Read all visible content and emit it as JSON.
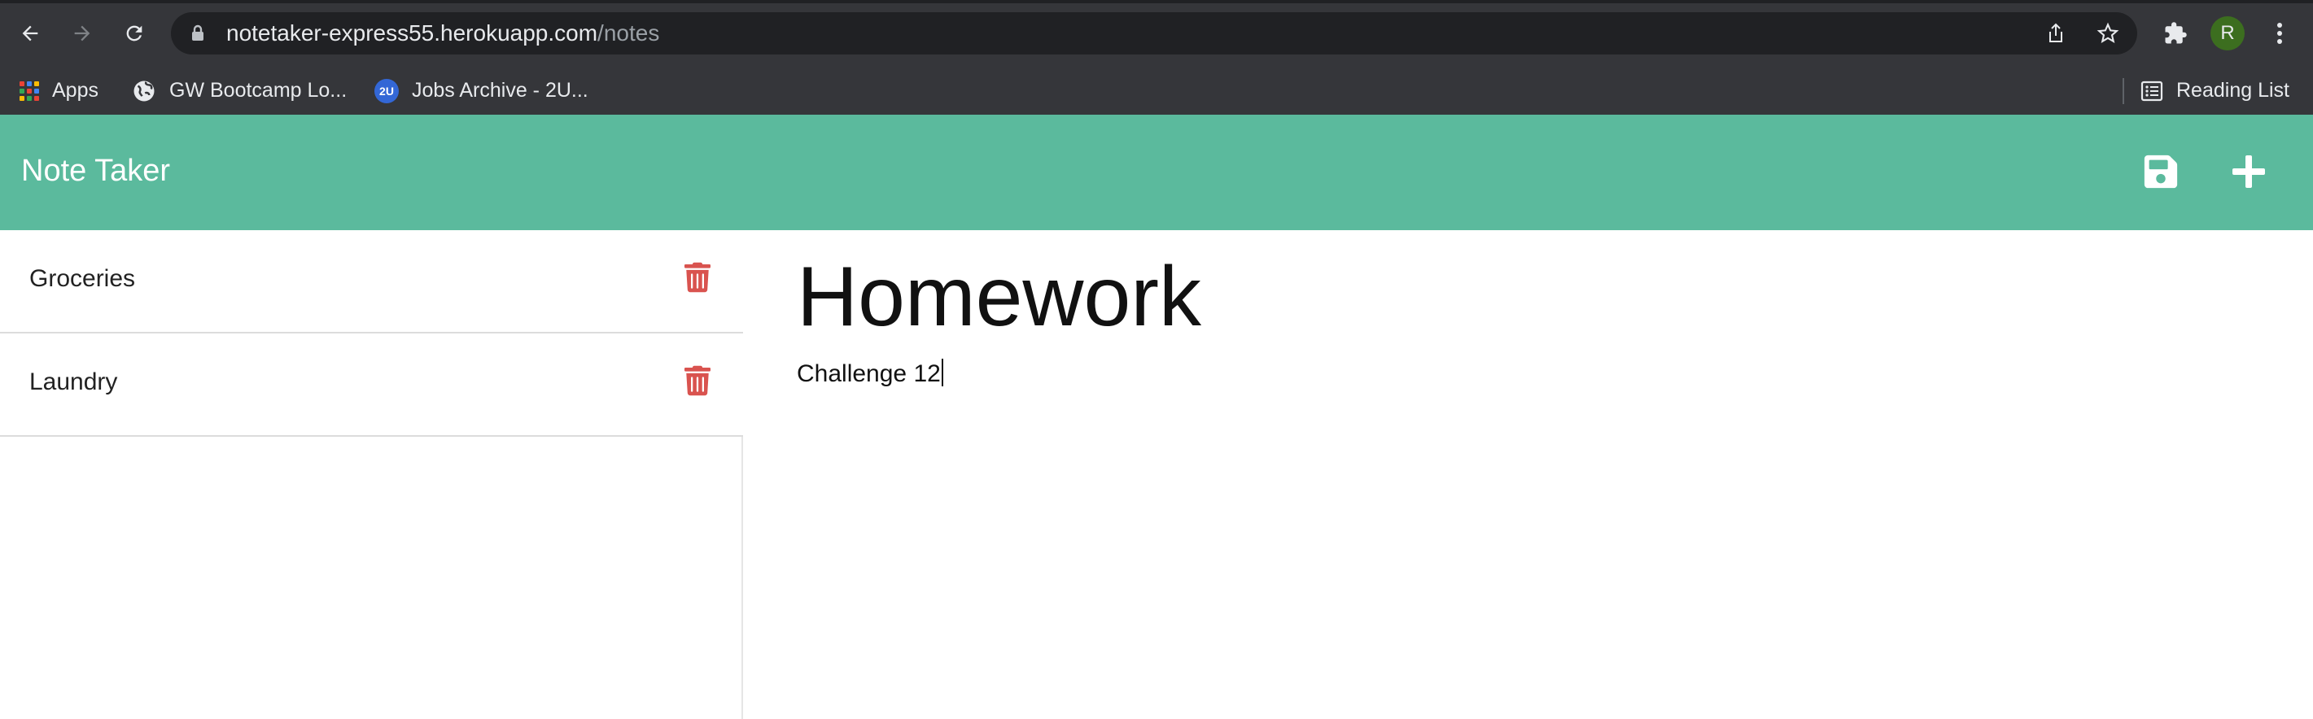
{
  "browser": {
    "url_host": "notetaker-express55.herokuapp.com",
    "url_path": "/notes",
    "profile_initial": "R",
    "bookmarks": [
      {
        "label": "Apps",
        "icon": "apps-grid-icon"
      },
      {
        "label": "GW Bootcamp Lo...",
        "icon": "globe-icon"
      },
      {
        "label": "Jobs Archive - 2U...",
        "icon": "2u-logo-icon",
        "icon_text": "2U"
      }
    ],
    "reading_list_label": "Reading List"
  },
  "app": {
    "title": "Note Taker",
    "header_actions": [
      {
        "name": "save-note",
        "icon": "floppy-disk-icon"
      },
      {
        "name": "new-note",
        "icon": "plus-icon"
      }
    ],
    "accent_color": "#5bba9d",
    "delete_color": "#d9534f"
  },
  "notes": [
    {
      "title": "Groceries"
    },
    {
      "title": "Laundry"
    }
  ],
  "editor": {
    "title": "Homework",
    "text": "Challenge 12"
  }
}
